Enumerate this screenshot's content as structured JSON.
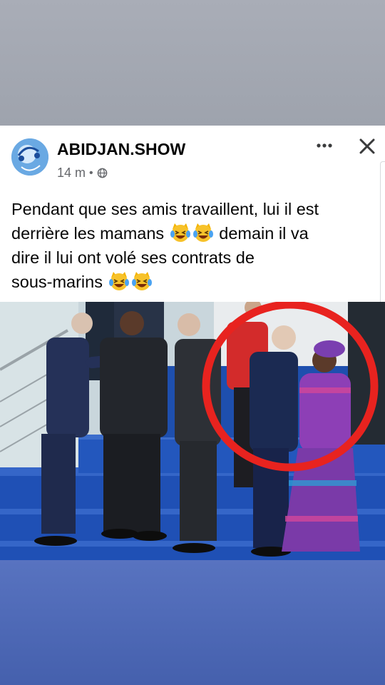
{
  "post": {
    "page_name": "ABIDJAN.SHOW",
    "time_ago": "14 m",
    "separator": "•",
    "privacy_icon": "globe-icon",
    "more_icon": "ellipsis-icon",
    "close_icon": "close-icon",
    "text_lines": [
      "Pendant que ses amis travaillent, lui il est",
      "derrière les mamans",
      "demain il va",
      "dire il lui ont volé ses contrats de",
      "sous-marins"
    ],
    "emoji_icon": "laughing-cat-with-tears-emoji",
    "photo_icon": "group-photo",
    "highlight_color": "#e8231f"
  },
  "colors": {
    "top_band": "#a9adb7",
    "bottom_band": "#4a67b5",
    "stage_blue": "#1f50b5"
  }
}
